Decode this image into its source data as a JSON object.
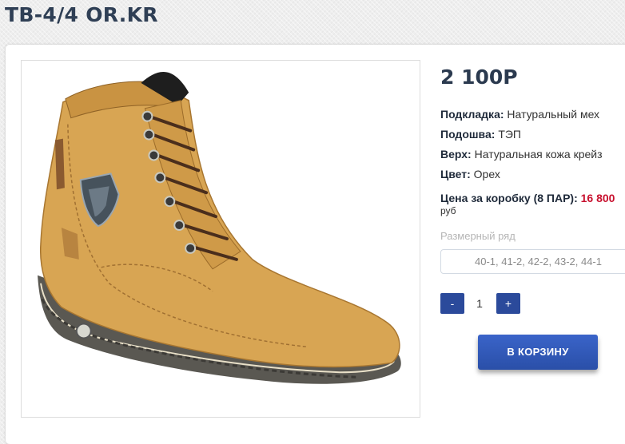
{
  "product": {
    "title": "TB-4/4 OR.KR",
    "price": "2 100Р",
    "specs": [
      {
        "label": "Подкладка:",
        "value": "Натуральный мех"
      },
      {
        "label": "Подошва:",
        "value": "ТЭП"
      },
      {
        "label": "Верх:",
        "value": "Натуральная кожа крейз"
      },
      {
        "label": "Цвет:",
        "value": "Орех"
      }
    ],
    "box_price": {
      "label": "Цена за коробку (8 ПАР):",
      "value": "16 800",
      "currency": "руб"
    },
    "size_range": {
      "label": "Размерный ряд",
      "value": "40-1, 41-2, 42-2, 43-2, 44-1"
    },
    "quantity": {
      "minus_label": "-",
      "value": "1",
      "plus_label": "+"
    },
    "cart_button_label": "В КОРЗИНУ",
    "image": {
      "name": "boot-image",
      "color": "#d8a553"
    }
  },
  "colors": {
    "title": "#2f3f55",
    "price_red": "#c8102e",
    "button": "#2b4a9b"
  }
}
